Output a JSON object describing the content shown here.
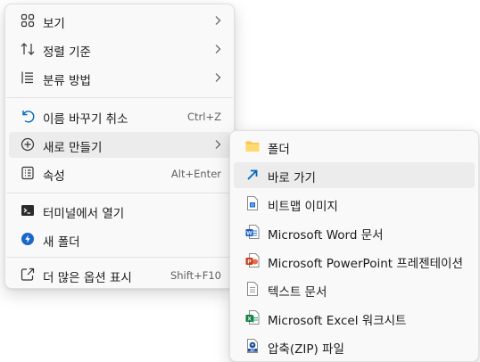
{
  "context_menu": {
    "items": [
      {
        "label": "보기",
        "icon": "grid-view-icon",
        "has_submenu": true
      },
      {
        "label": "정렬 기준",
        "icon": "sort-arrows-icon",
        "has_submenu": true
      },
      {
        "label": "분류 방법",
        "icon": "group-list-icon",
        "has_submenu": true
      },
      {
        "label": "이름 바꾸기 취소",
        "icon": "undo-icon",
        "shortcut": "Ctrl+Z"
      },
      {
        "label": "새로 만들기",
        "icon": "add-circle-icon",
        "has_submenu": true
      },
      {
        "label": "속성",
        "icon": "properties-icon",
        "shortcut": "Alt+Enter"
      },
      {
        "label": "터미널에서 열기",
        "icon": "terminal-icon"
      },
      {
        "label": "새 폴더",
        "icon": "new-folder-icon"
      },
      {
        "label": "더 많은 옵션 표시",
        "icon": "more-options-icon",
        "shortcut": "Shift+F10"
      }
    ]
  },
  "new_submenu": {
    "items": [
      {
        "label": "폴더",
        "icon": "folder-icon"
      },
      {
        "label": "바로 가기",
        "icon": "shortcut-arrow-icon"
      },
      {
        "label": "비트맵 이미지",
        "icon": "bitmap-icon"
      },
      {
        "label": "Microsoft Word 문서",
        "icon": "word-icon"
      },
      {
        "label": "Microsoft PowerPoint 프레젠테이션",
        "icon": "powerpoint-icon"
      },
      {
        "label": "텍스트 문서",
        "icon": "text-document-icon"
      },
      {
        "label": "Microsoft Excel 워크시트",
        "icon": "excel-icon"
      },
      {
        "label": "압축(ZIP) 파일",
        "icon": "zip-icon"
      }
    ]
  },
  "colors": {
    "accent": "#0067c0",
    "hover": "#ececec",
    "word": "#185abd",
    "powerpoint": "#c43e1c",
    "excel": "#107c41",
    "folder": "#f8c44f"
  }
}
